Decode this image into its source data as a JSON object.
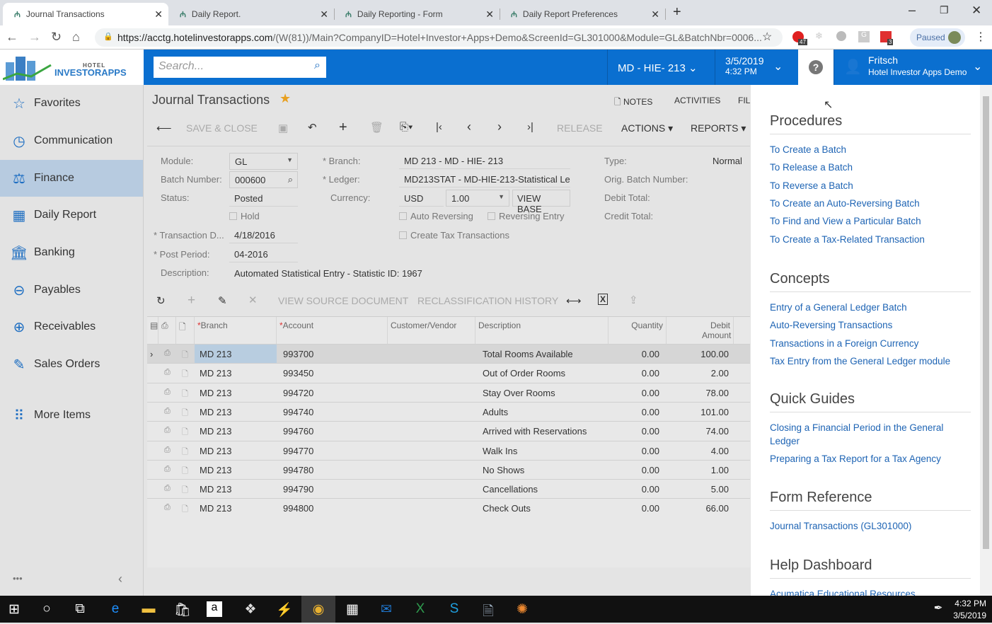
{
  "browser": {
    "tabs": [
      {
        "title": "Journal Transactions"
      },
      {
        "title": "Daily Report."
      },
      {
        "title": "Daily Reporting - Form"
      },
      {
        "title": "Daily Report Preferences"
      }
    ],
    "url_host": "https://acctg.hotelinvestorapps.com",
    "url_rest": "/(W(81))/Main?CompanyID=Hotel+Investor+Apps+Demo&ScreenId=GL301000&Module=GL&BatchNbr=0006...",
    "profile_status": "Paused",
    "ext_badge_1": "47",
    "ext_badge_2": "3"
  },
  "header": {
    "logo_top": "HOTEL",
    "logo_bottom": "INVESTORAPPS",
    "search_placeholder": "Search...",
    "branch": "MD - HIE- 213",
    "date": "3/5/2019",
    "time": "4:32 PM",
    "user_name": "Fritsch",
    "company": "Hotel Investor Apps Demo",
    "brand_color": "#0a6fd0"
  },
  "sidebar": {
    "items": [
      {
        "label": "Favorites",
        "icon": "star-icon"
      },
      {
        "label": "Communication",
        "icon": "clock-icon"
      },
      {
        "label": "Finance",
        "icon": "scale-icon"
      },
      {
        "label": "Daily Report",
        "icon": "report-icon"
      },
      {
        "label": "Banking",
        "icon": "bank-icon"
      },
      {
        "label": "Payables",
        "icon": "minus-circle-icon"
      },
      {
        "label": "Receivables",
        "icon": "plus-circle-icon"
      },
      {
        "label": "Sales Orders",
        "icon": "edit-icon"
      },
      {
        "label": "More Items",
        "icon": "grid-icon"
      }
    ],
    "selected": "Finance",
    "more": "•••",
    "collapse": "‹"
  },
  "page": {
    "title": "Journal Transactions",
    "links": {
      "notes": "NOTES",
      "activities": "ACTIVITIES",
      "files": "FIL"
    },
    "toolbar": {
      "save_close": "SAVE & CLOSE",
      "release": "RELEASE",
      "actions": "ACTIONS",
      "reports": "REPORTS"
    },
    "form": {
      "module_label": "Module:",
      "module": "GL",
      "batch_label": "Batch Number:",
      "batch": "000600",
      "status_label": "Status:",
      "status": "Posted",
      "hold_label": "Hold",
      "trandate_label": "Transaction D...",
      "trandate": "4/18/2016",
      "period_label": "Post Period:",
      "period": "04-2016",
      "desc_label": "Description:",
      "desc": "Automated Statistical Entry - Statistic ID: 1967",
      "branch_label": "Branch:",
      "branch": "MD 213 - MD - HIE- 213",
      "ledger_label": "Ledger:",
      "ledger": "MD213STAT - MD-HIE-213-Statistical Le",
      "currency_label": "Currency:",
      "currency": "USD",
      "rate": "1.00",
      "view_base": "VIEW BASE",
      "auto_rev": "Auto Reversing",
      "rev_entry": "Reversing Entry",
      "create_tax": "Create Tax Transactions",
      "type_label": "Type:",
      "type": "Normal",
      "orig_label": "Orig. Batch Number:",
      "debit_label": "Debit Total:",
      "credit_label": "Credit Total:"
    },
    "grid_toolbar": {
      "view_source": "VIEW SOURCE DOCUMENT",
      "reclass": "RECLASSIFICATION HISTORY"
    },
    "grid": {
      "columns": {
        "branch": "Branch",
        "account": "Account",
        "customer": "Customer/Vendor",
        "description": "Description",
        "quantity": "Quantity",
        "debit": "Debit Amount"
      },
      "rows": [
        {
          "branch": "MD 213",
          "account": "993700",
          "description": "Total Rooms Available",
          "quantity": "0.00",
          "debit": "100.00"
        },
        {
          "branch": "MD 213",
          "account": "993450",
          "description": "Out of Order Rooms",
          "quantity": "0.00",
          "debit": "2.00"
        },
        {
          "branch": "MD 213",
          "account": "994720",
          "description": "Stay Over Rooms",
          "quantity": "0.00",
          "debit": "78.00"
        },
        {
          "branch": "MD 213",
          "account": "994740",
          "description": "Adults",
          "quantity": "0.00",
          "debit": "101.00"
        },
        {
          "branch": "MD 213",
          "account": "994760",
          "description": "Arrived with Reservations",
          "quantity": "0.00",
          "debit": "74.00"
        },
        {
          "branch": "MD 213",
          "account": "994770",
          "description": "Walk Ins",
          "quantity": "0.00",
          "debit": "4.00"
        },
        {
          "branch": "MD 213",
          "account": "994780",
          "description": "No Shows",
          "quantity": "0.00",
          "debit": "1.00"
        },
        {
          "branch": "MD 213",
          "account": "994790",
          "description": "Cancellations",
          "quantity": "0.00",
          "debit": "5.00"
        },
        {
          "branch": "MD 213",
          "account": "994800",
          "description": "Check Outs",
          "quantity": "0.00",
          "debit": "66.00"
        }
      ]
    }
  },
  "help": {
    "sections": [
      {
        "title": "Procedures",
        "links": [
          "To Create a Batch",
          "To Release a Batch",
          "To Reverse a Batch",
          "To Create an Auto-Reversing Batch",
          "To Find and View a Particular Batch",
          "To Create a Tax-Related Transaction"
        ]
      },
      {
        "title": "Concepts",
        "links": [
          "Entry of a General Ledger Batch",
          "Auto-Reversing Transactions",
          "Transactions in a Foreign Currency",
          "Tax Entry from the General Ledger module"
        ]
      },
      {
        "title": "Quick Guides",
        "links": [
          "Closing a Financial Period in the General Ledger",
          "Preparing a Tax Report for a Tax Agency"
        ]
      },
      {
        "title": "Form Reference",
        "links": [
          "Journal Transactions (GL301000)"
        ]
      },
      {
        "title": "Help Dashboard",
        "links": [
          "Acumatica Educational Resources"
        ]
      }
    ]
  },
  "taskbar": {
    "time": "4:32 PM",
    "date": "3/5/2019"
  }
}
